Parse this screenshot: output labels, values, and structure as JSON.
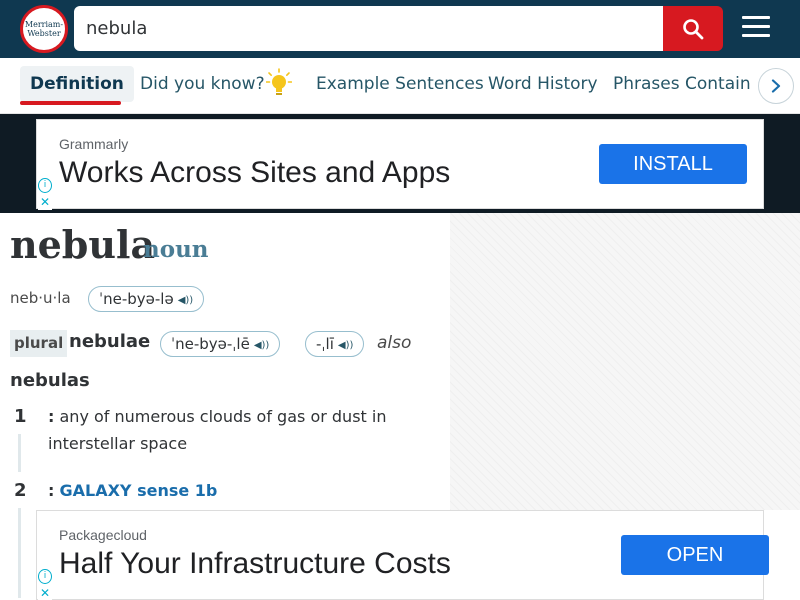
{
  "header": {
    "logo_line1": "Merriam-",
    "logo_line2": "Webster",
    "search_value": "nebula",
    "search_icon": "search-icon",
    "menu_icon": "hamburger-menu-icon",
    "colors": {
      "bar": "#0f3850",
      "accent": "#d71920"
    }
  },
  "tabs": {
    "items": [
      "Definition",
      "Did you know?",
      "Example Sentences",
      "Word History",
      "Phrases Containin"
    ],
    "active": "Definition",
    "bulb_icon": "lightbulb-icon",
    "next_icon": "chevron-right-icon"
  },
  "ads": {
    "top": {
      "sponsor": "Grammarly",
      "headline": "Works Across Sites and Apps",
      "cta": "INSTALL"
    },
    "bottom": {
      "sponsor": "Packagecloud",
      "headline": "Half Your Infrastructure Costs",
      "cta": "OPEN"
    },
    "info_glyph": "i",
    "close_glyph": "✕"
  },
  "entry": {
    "headword": "nebula",
    "pos": "noun",
    "syllables": "neb·u·la",
    "pronunciation": "ˈne-byə-lə",
    "plural_label": "plural",
    "plural": "nebulae",
    "plural_pron_1": "ˈne-byə-ˌlē",
    "plural_pron_2": "-ˌlī",
    "also_label": "also",
    "alt_plural": "nebulas",
    "speaker_icon": "speaker-icon",
    "senses": [
      {
        "num": "1",
        "colon": ":",
        "text": "any of numerous clouds of gas or dust in interstellar space"
      },
      {
        "num": "2",
        "colon": ":",
        "xref": "GALAXY sense 1b"
      }
    ]
  }
}
